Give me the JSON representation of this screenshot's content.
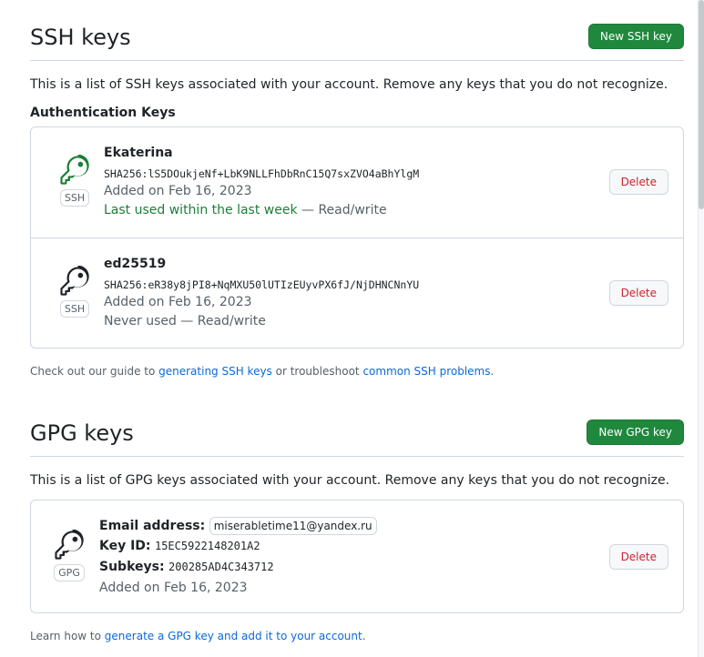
{
  "ssh": {
    "title": "SSH keys",
    "new_button": "New SSH key",
    "intro": "This is a list of SSH keys associated with your account. Remove any keys that you do not recognize.",
    "subheading": "Authentication Keys",
    "keys": [
      {
        "title": "Ekaterina",
        "fingerprint": "SHA256:lS5DOukjeNf+LbK9NLLFhDbRnC15Q7sxZVO4aBhYlgM",
        "added": "Added on Feb 16, 2023",
        "last_used": "Last used within the last week",
        "access": " — Read/write",
        "type": "SSH",
        "delete": "Delete",
        "icon_color": "#1a7f37"
      },
      {
        "title": "ed25519",
        "fingerprint": "SHA256:eR38y8jPI8+NqMXU50lUTIzEUyvPX6fJ/NjDHNCNnYU",
        "added": "Added on Feb 16, 2023",
        "last_used": "Never used",
        "access": " — Read/write",
        "type": "SSH",
        "delete": "Delete",
        "icon_color": "#1f2328"
      }
    ],
    "note_prefix": "Check out our guide to ",
    "note_link1": "generating SSH keys",
    "note_mid": " or troubleshoot ",
    "note_link2": "common SSH problems",
    "note_suffix": "."
  },
  "gpg": {
    "title": "GPG keys",
    "new_button": "New GPG key",
    "intro": "This is a list of GPG keys associated with your account. Remove any keys that you do not recognize.",
    "key": {
      "email_label": "Email address:",
      "email": "miserabletime11@yandex.ru",
      "keyid_label": "Key ID:",
      "keyid": "15EC5922148201A2",
      "subkeys_label": "Subkeys:",
      "subkeys": "200285AD4C343712",
      "added": "Added on Feb 16, 2023",
      "type": "GPG",
      "delete": "Delete"
    },
    "note_prefix": "Learn how to ",
    "note_link": "generate a GPG key and add it to your account",
    "note_suffix": "."
  },
  "colors": {
    "primary_button": "#1f883d",
    "danger_text": "#cf222e",
    "link": "#0969da",
    "success_text": "#1a7f37"
  },
  "icons": [
    "key-icon"
  ]
}
